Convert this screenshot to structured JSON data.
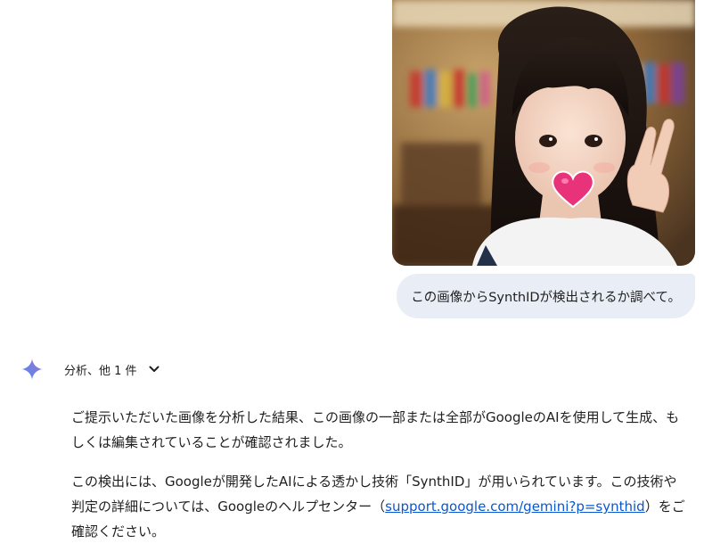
{
  "user_message": {
    "text": "この画像からSynthIDが検出されるか調べて。"
  },
  "model_response": {
    "analysis_toggle": {
      "label": "分析、他 1 件",
      "icon": "chevron-down-icon"
    },
    "spark_icon": "gemini-spark-icon",
    "paragraph1": "ご提示いただいた画像を分析した結果、この画像の一部または全部がGoogleのAIを使用して生成、もしくは編集されていることが確認されました。",
    "paragraph2_before_link": "この検出には、Googleが開発したAIによる透かし技術「SynthID」が用いられています。この技術や判定の詳細については、Googleのヘルプセンター（",
    "paragraph2_link": "support.google.com/gemini?p=synthid",
    "paragraph2_after_link": "）をご確認ください。"
  },
  "colors": {
    "user_bubble_bg": "#e9eef6",
    "link": "#0b57d0",
    "spark_gradient_start": "#4c8df6",
    "spark_gradient_end": "#9b72cb"
  }
}
